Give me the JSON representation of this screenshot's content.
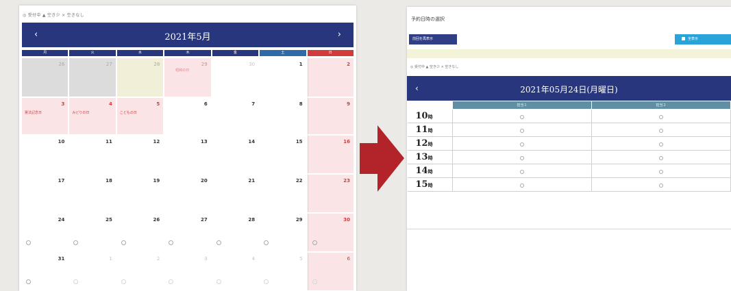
{
  "left": {
    "legend": "◎ 受付中 ▲ 空き少 × 空きなし",
    "calendar_title": "2021年5月",
    "prev_label": "‹",
    "next_label": "›",
    "weekdays": [
      {
        "label": "月",
        "color": "#27367d"
      },
      {
        "label": "火",
        "color": "#27367d"
      },
      {
        "label": "水",
        "color": "#27367d"
      },
      {
        "label": "木",
        "color": "#27367d"
      },
      {
        "label": "金",
        "color": "#27367d"
      },
      {
        "label": "土",
        "color": "#2f6aa8"
      },
      {
        "label": "日",
        "color": "#d23b3b"
      }
    ],
    "weeks": [
      [
        {
          "day": "26",
          "style": "muted"
        },
        {
          "day": "27",
          "style": "muted"
        },
        {
          "day": "28",
          "style": "cream"
        },
        {
          "day": "29",
          "style": "pink pinkdate",
          "label": "昭和の日"
        },
        {
          "day": "30",
          "style": "faded"
        },
        {
          "day": "1",
          "style": ""
        },
        {
          "day": "2",
          "style": "sun red"
        }
      ],
      [
        {
          "day": "3",
          "style": "pink red",
          "label": "憲法記念日"
        },
        {
          "day": "4",
          "style": "pink red",
          "label": "みどりの日"
        },
        {
          "day": "5",
          "style": "pink red",
          "label": "こどもの日"
        },
        {
          "day": "6",
          "style": ""
        },
        {
          "day": "7",
          "style": ""
        },
        {
          "day": "8",
          "style": ""
        },
        {
          "day": "9",
          "style": "sun red"
        }
      ],
      [
        {
          "day": "10",
          "style": ""
        },
        {
          "day": "11",
          "style": ""
        },
        {
          "day": "12",
          "style": ""
        },
        {
          "day": "13",
          "style": ""
        },
        {
          "day": "14",
          "style": ""
        },
        {
          "day": "15",
          "style": ""
        },
        {
          "day": "16",
          "style": "sun red"
        }
      ],
      [
        {
          "day": "17",
          "style": ""
        },
        {
          "day": "18",
          "style": ""
        },
        {
          "day": "19",
          "style": ""
        },
        {
          "day": "20",
          "style": ""
        },
        {
          "day": "21",
          "style": ""
        },
        {
          "day": "22",
          "style": ""
        },
        {
          "day": "23",
          "style": "sun red"
        }
      ],
      [
        {
          "day": "24",
          "style": "",
          "dot": true
        },
        {
          "day": "25",
          "style": "",
          "dot": true
        },
        {
          "day": "26",
          "style": "",
          "dot": true
        },
        {
          "day": "27",
          "style": "",
          "dot": true
        },
        {
          "day": "28",
          "style": "",
          "dot": true
        },
        {
          "day": "29",
          "style": "",
          "dot": true
        },
        {
          "day": "30",
          "style": "sun red",
          "dot": true
        }
      ],
      [
        {
          "day": "31",
          "style": "",
          "dot": true
        },
        {
          "day": "1",
          "style": "faded",
          "dot": true
        },
        {
          "day": "2",
          "style": "faded",
          "dot": true
        },
        {
          "day": "3",
          "style": "faded",
          "dot": true
        },
        {
          "day": "4",
          "style": "faded",
          "dot": true
        },
        {
          "day": "5",
          "style": "faded",
          "dot": true
        },
        {
          "day": "6",
          "style": "sun red faded",
          "dot": true
        }
      ]
    ]
  },
  "right": {
    "title": "予約日時の選択",
    "left_button": "前回を再表示",
    "right_button": "全表示",
    "legend": "◎ 受付中 ▲ 空き少 × 空きなし",
    "prev_label": "‹",
    "date_title": "2021年05月24日(月曜日)",
    "columns": [
      "担当１",
      "担当２"
    ],
    "time_unit": "時",
    "rows": [
      {
        "hour": "10",
        "slots": [
          "◎",
          "◎"
        ]
      },
      {
        "hour": "11",
        "slots": [
          "◎",
          "◎"
        ]
      },
      {
        "hour": "12",
        "slots": [
          "◎",
          "◎"
        ]
      },
      {
        "hour": "13",
        "slots": [
          "◎",
          "◎"
        ]
      },
      {
        "hour": "14",
        "slots": [
          "◎",
          "◎"
        ]
      },
      {
        "hour": "15",
        "slots": [
          "◎",
          "◎"
        ]
      }
    ]
  },
  "colors": {
    "header_navy": "#27367d",
    "holiday_pink": "#fbe4e6",
    "arrow_red": "#b3232a",
    "column_header": "#5f8fa1",
    "button_blue": "#2aa4d8"
  }
}
